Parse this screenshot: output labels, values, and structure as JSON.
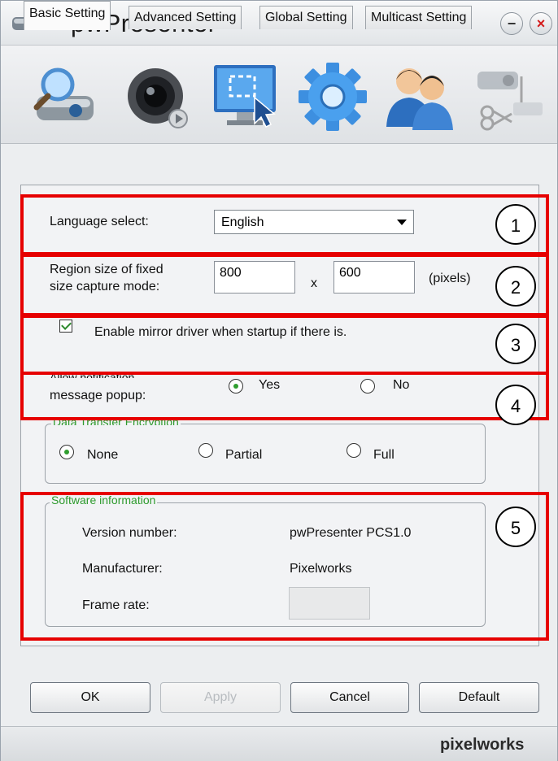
{
  "window": {
    "title": "pwPresenter"
  },
  "title_controls": {
    "minimize": "−",
    "close": "×"
  },
  "toolbar": {
    "tools": [
      {
        "icon": "search-projector-icon"
      },
      {
        "icon": "camera-lens-icon"
      },
      {
        "icon": "screen-capture-region-icon"
      },
      {
        "icon": "settings-gear-icon",
        "active": true
      },
      {
        "icon": "users-icon"
      },
      {
        "icon": "projector-tools-icon"
      }
    ]
  },
  "tabs": [
    {
      "label": "Basic Setting",
      "active": true
    },
    {
      "label": "Advanced Setting"
    },
    {
      "label": "Global Setting"
    },
    {
      "label": "Multicast Setting"
    }
  ],
  "basic": {
    "language_label": "Language select:",
    "language_value": "English",
    "region_label_line1": "Region size of fixed",
    "region_label_line2": "size capture mode:",
    "width_value": "800",
    "times": "x",
    "height_value": "600",
    "unit": "(pixels)",
    "mirror_label": "Enable mirror driver when startup if there is.",
    "mirror_checked": true,
    "notify_label_line1": "Allow notification",
    "notify_label_line2": "message popup:",
    "notify_yes": "Yes",
    "notify_no": "No",
    "notify_selected": "Yes",
    "encryption_title": "Data Transfer Encryption",
    "enc_none": "None",
    "enc_partial": "Partial",
    "enc_full": "Full",
    "enc_selected": "None",
    "software_title": "Software information",
    "version_label": "Version number:",
    "version_value": "pwPresenter PCS1.0",
    "manufacturer_label": "Manufacturer:",
    "manufacturer_value": "Pixelworks",
    "framerate_label": "Frame rate:",
    "framerate_value": ""
  },
  "annotations": {
    "highlight_color": "#e60000",
    "labels": [
      "1",
      "2",
      "3",
      "4",
      "5"
    ]
  },
  "buttons": {
    "ok": "OK",
    "apply": "Apply",
    "cancel": "Cancel",
    "default": "Default"
  },
  "footer": {
    "brand": "pixelworks"
  }
}
